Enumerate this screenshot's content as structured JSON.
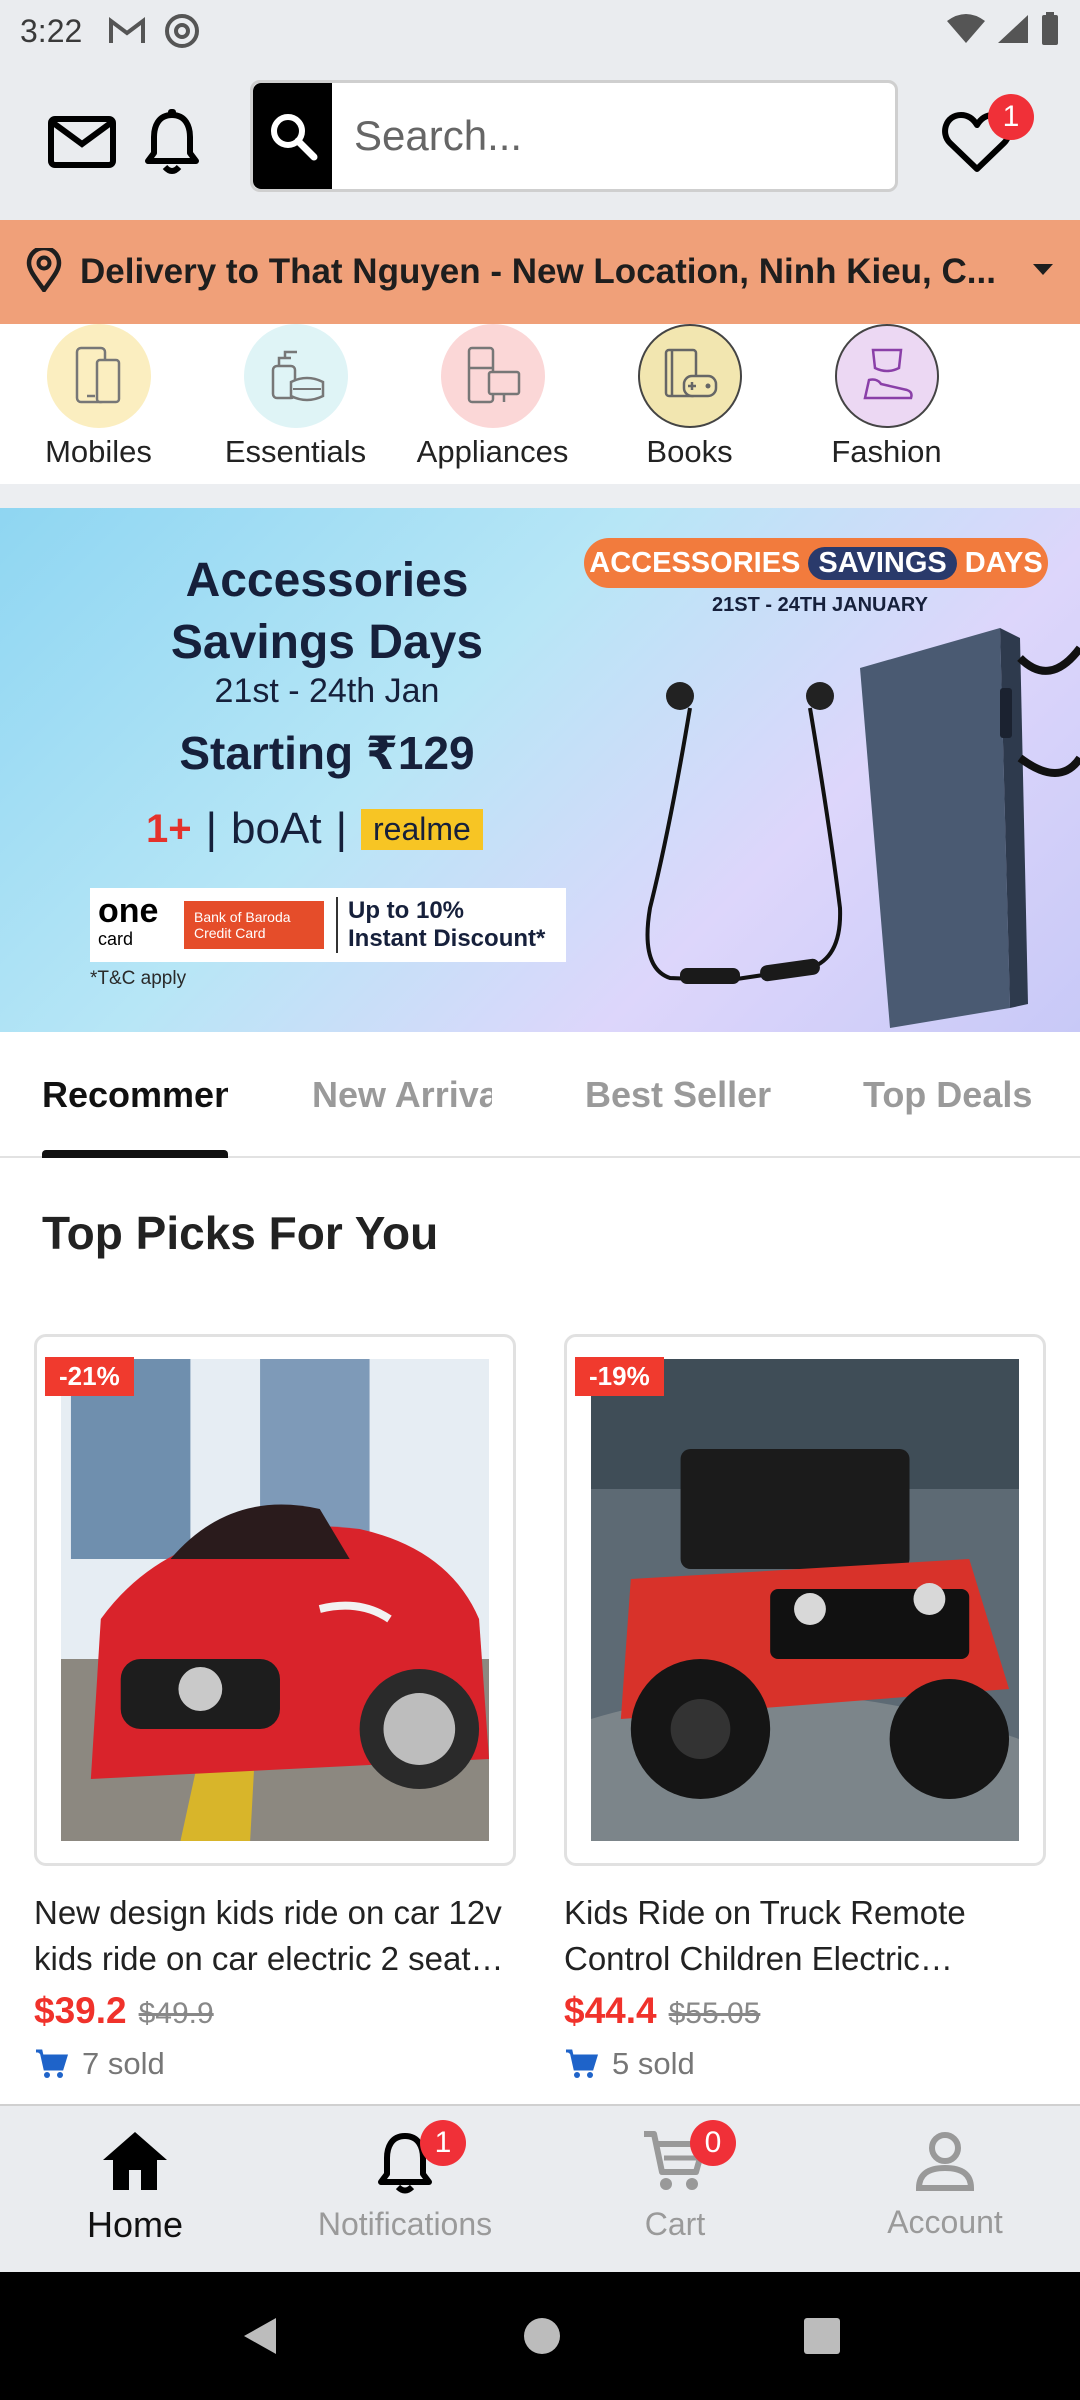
{
  "status_bar": {
    "time": "3:22"
  },
  "header": {
    "search_placeholder": "Search...",
    "wishlist_count": "1"
  },
  "delivery": {
    "text": "Delivery to That Nguyen - New Location, Ninh Kieu, C..."
  },
  "categories": [
    {
      "label": "Mobiles",
      "color": "#fbeec0"
    },
    {
      "label": "Essentials",
      "color": "#dff4f6"
    },
    {
      "label": "Appliances",
      "color": "#fbd7d7"
    },
    {
      "label": "Books",
      "color": "#f2e6b0"
    },
    {
      "label": "Fashion",
      "color": "#ecd8f3"
    }
  ],
  "banner": {
    "title_line1": "Accessories",
    "title_line2": "Savings Days",
    "dates": "21st - 24th Jan",
    "starting": "Starting ₹129",
    "brand1": "1+",
    "brand2": "boAt",
    "brand3": "realme",
    "card_name": "one",
    "card_sub": "card",
    "bank": "Bank of Baroda Credit Card",
    "discount_line1": "Up to 10%",
    "discount_line2": "Instant Discount*",
    "tc": "*T&C apply",
    "pill_left": "ACCESSORIES",
    "pill_mid": "SAVINGS",
    "pill_right": "DAYS",
    "pill_dates": "21ST - 24TH JANUARY"
  },
  "tabs": [
    {
      "label": "Recommended",
      "active": true
    },
    {
      "label": "New Arrivals",
      "active": false
    },
    {
      "label": "Best Seller",
      "active": false
    },
    {
      "label": "Top Deals",
      "active": false
    }
  ],
  "section_title": "Top Picks For You",
  "products": [
    {
      "discount": "-21%",
      "title": "New design kids ride on car 12v kids ride on car electric 2 seat…",
      "price": "$39.2",
      "old_price": "$49.9",
      "sold": "7 sold"
    },
    {
      "discount": "-19%",
      "title": "Kids Ride on Truck Remote Control Children Electric Car,R…",
      "price": "$44.4",
      "old_price": "$55.05",
      "sold": "5 sold"
    }
  ],
  "bottom_nav": {
    "home": "Home",
    "notifications": "Notifications",
    "notifications_count": "1",
    "cart": "Cart",
    "cart_count": "0",
    "account": "Account"
  },
  "colors": {
    "accent_red": "#f03038",
    "delivery_bg": "#f0a079",
    "header_bg": "#eaecef"
  }
}
